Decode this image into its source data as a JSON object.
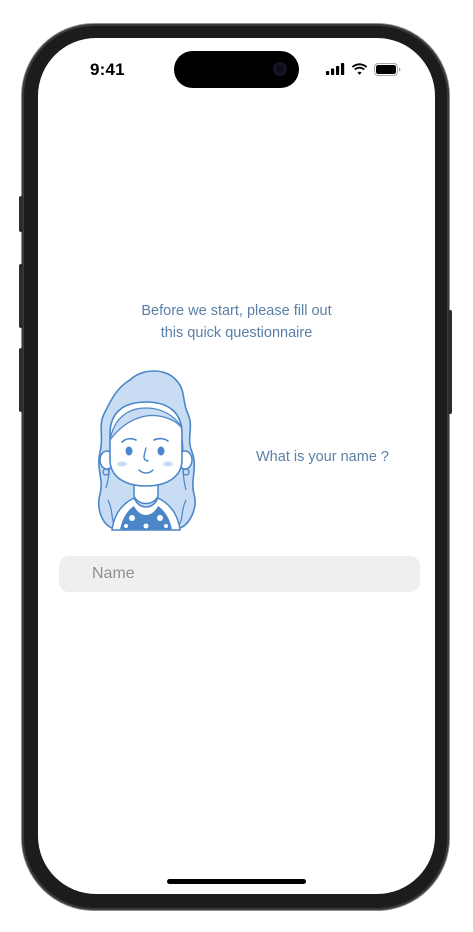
{
  "status_bar": {
    "time": "9:41",
    "icons": [
      "cellular-signal-icon",
      "wifi-icon",
      "battery-icon"
    ]
  },
  "intro": {
    "line1": "Before we start, please fill out",
    "line2": "this quick questionnaire"
  },
  "question": {
    "text": "What is your name ?"
  },
  "name_field": {
    "placeholder": "Name",
    "value": ""
  },
  "colors": {
    "accent_text": "#5a7fa8",
    "illustration_fill": "#c8dcf4",
    "illustration_stroke": "#4a86c8",
    "input_bg": "#efefef"
  },
  "illustration": {
    "name": "woman-avatar-illustration"
  }
}
